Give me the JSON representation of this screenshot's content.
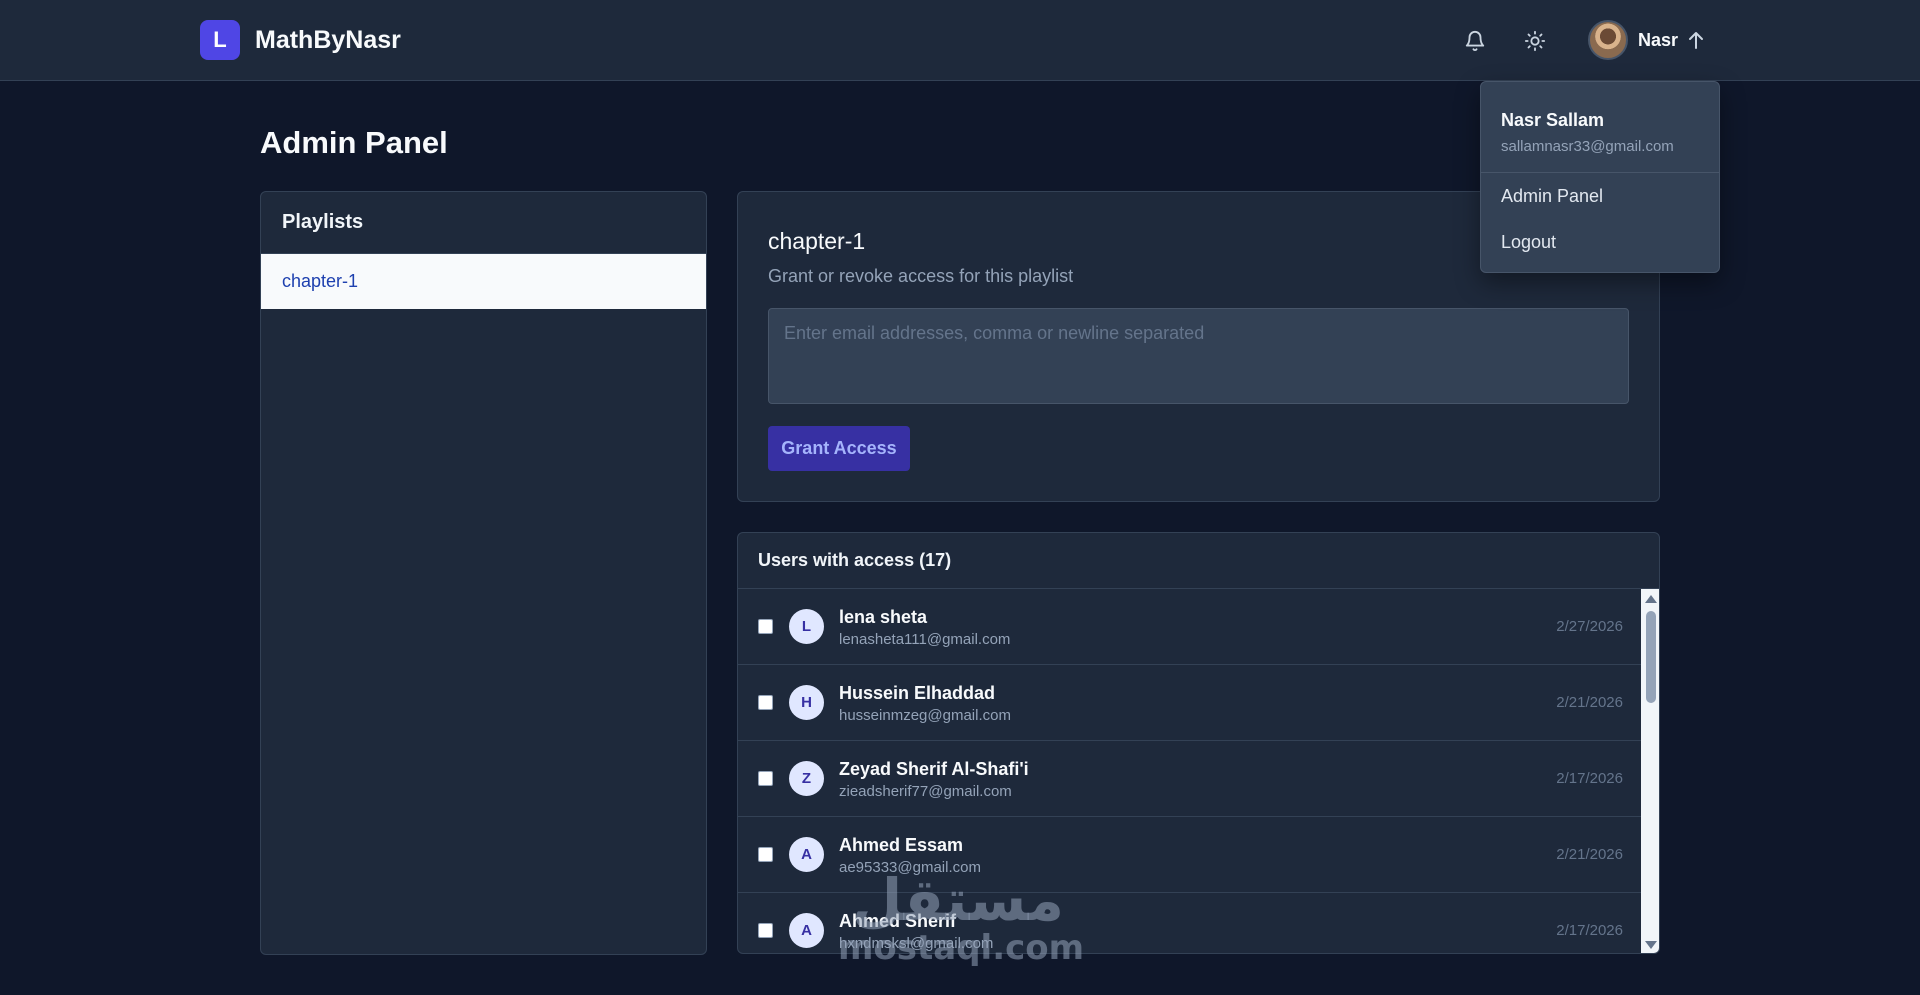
{
  "header": {
    "logo_letter": "L",
    "brand": "MathByNasr",
    "user_short": "Nasr"
  },
  "dropdown": {
    "name": "Nasr Sallam",
    "email": "sallamnasr33@gmail.com",
    "items": [
      "Admin Panel",
      "Logout"
    ]
  },
  "page": {
    "title": "Admin Panel"
  },
  "playlists": {
    "heading": "Playlists",
    "items": [
      "chapter-1"
    ]
  },
  "grant": {
    "title": "chapter-1",
    "subtitle": "Grant or revoke access for this playlist",
    "placeholder": "Enter email addresses, comma or newline separated",
    "button": "Grant Access"
  },
  "users": {
    "heading": "Users with access (17)",
    "rows": [
      {
        "initial": "L",
        "name": "lena sheta",
        "email": "lenasheta111@gmail.com",
        "date": "2/27/2026"
      },
      {
        "initial": "H",
        "name": "Hussein Elhaddad",
        "email": "husseinmzeg@gmail.com",
        "date": "2/21/2026"
      },
      {
        "initial": "Z",
        "name": "Zeyad Sherif Al-Shafi'i",
        "email": "zieadsherif77@gmail.com",
        "date": "2/17/2026"
      },
      {
        "initial": "A",
        "name": "Ahmed Essam",
        "email": "ae95333@gmail.com",
        "date": "2/21/2026"
      },
      {
        "initial": "A",
        "name": "Ahmed Sherif",
        "email": "hxndmsksl@gmail.com",
        "date": "2/17/2026"
      }
    ]
  },
  "watermark": {
    "arabic": "مستقل",
    "latin": "mostaql.com"
  },
  "colors": {
    "background": "#0f172a",
    "surface": "#1e293b",
    "accent": "#4f46e5",
    "button": "#3730a3"
  }
}
